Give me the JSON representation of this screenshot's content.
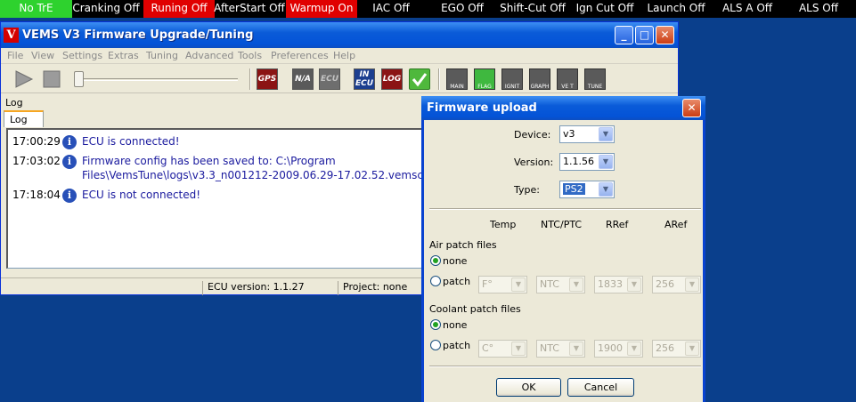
{
  "status_strip": [
    {
      "label": "No TrE",
      "color": "#2ed22e"
    },
    {
      "label": "Cranking Off",
      "color": "#000000"
    },
    {
      "label": "Runing Off",
      "color": "#e00000"
    },
    {
      "label": "AfterStart Off",
      "color": "#000000"
    },
    {
      "label": "Warmup On",
      "color": "#e00000"
    },
    {
      "label": "IAC Off",
      "color": "#000000"
    },
    {
      "label": "EGO Off",
      "color": "#000000"
    },
    {
      "label": "Shift-Cut Off",
      "color": "#000000"
    },
    {
      "label": "Ign Cut Off",
      "color": "#000000"
    },
    {
      "label": "Launch Off",
      "color": "#000000"
    },
    {
      "label": "ALS A Off",
      "color": "#000000"
    },
    {
      "label": "ALS Off",
      "color": "#000000"
    }
  ],
  "window": {
    "logo": "V",
    "title": "VEMS V3 Firmware Upgrade/Tuning",
    "btn_minimize": "_",
    "btn_maximize": "□",
    "btn_close": "✕"
  },
  "menu": [
    "File",
    "View",
    "Settings",
    "Extras",
    "Tuning",
    "Advanced",
    "Tools",
    "Preferences",
    "Help"
  ],
  "toolbar": {
    "play_icon": "play-icon",
    "stop_icon": "stop-icon",
    "gps": "GPS",
    "nia": "N/A",
    "ecu": "ECU",
    "in_ecu_top": "IN",
    "in_ecu_bottom": "ECU",
    "log": "LOG",
    "ok_icon": "check-icon",
    "gauges": [
      "MAIN",
      "FLAG",
      "IGNIT",
      "GRAPH",
      "VE T",
      "TUNE"
    ]
  },
  "log": {
    "panel_title": "Log",
    "tab": "Log",
    "entries": [
      {
        "time": "17:00:29",
        "icon": "i",
        "lines": [
          "ECU is connected!"
        ]
      },
      {
        "time": "17:03:02",
        "icon": "i",
        "lines": [
          "Firmware config has been saved to: C:\\Program",
          "Files\\VemsTune\\logs\\v3.3_n001212-2009.06.29-17.02.52.vemscfg"
        ]
      },
      {
        "time": "17:18:04",
        "icon": "i",
        "lines": [
          "ECU is not connected!"
        ]
      }
    ]
  },
  "statusbar": {
    "ecu_version": "ECU version: 1.1.27",
    "project": "Project: none"
  },
  "dialog": {
    "title": "Firmware upload",
    "close": "✕",
    "device_label": "Device:",
    "device_value": "v3",
    "version_label": "Version:",
    "version_value": "1.1.56",
    "type_label": "Type:",
    "type_value": "PS2",
    "col_temp": "Temp",
    "col_ntc": "NTC/PTC",
    "col_rref": "RRef",
    "col_aref": "ARef",
    "air_title": "Air patch files",
    "air_none": "none",
    "air_patch": "patch",
    "air_temp": "F°",
    "air_ntc": "NTC",
    "air_rref": "1833",
    "air_aref": "256",
    "coolant_title": "Coolant patch files",
    "coolant_none": "none",
    "coolant_patch": "patch",
    "coolant_temp": "C°",
    "coolant_ntc": "NTC",
    "coolant_rref": "1900",
    "coolant_aref": "256",
    "ok": "OK",
    "cancel": "Cancel"
  }
}
